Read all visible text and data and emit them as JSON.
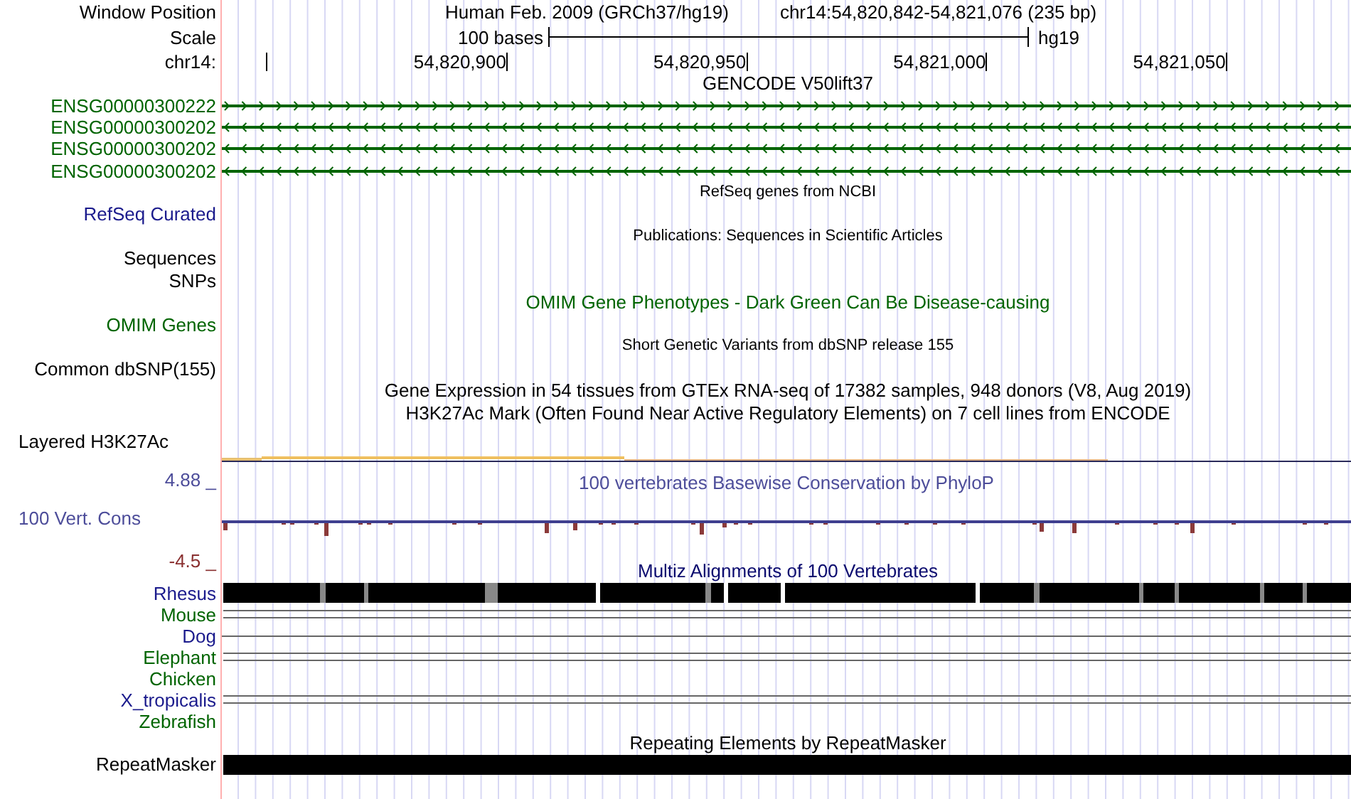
{
  "tracks": [
    {
      "kind": "header",
      "label": "Window Position",
      "assembly": "Human Feb. 2009 (GRCh37/hg19)",
      "position": "chr14:54,820,842-54,821,076 (235 bp)"
    },
    {
      "kind": "scale",
      "label": "Scale",
      "length": "100 bases",
      "db": "hg19"
    },
    {
      "kind": "ruler",
      "label": "chr14:",
      "ticks": [
        "54,820,900",
        "54,820,950",
        "54,821,000",
        "54,821,050"
      ]
    },
    {
      "kind": "title",
      "text": "GENCODE V50lift37",
      "color": "#000000"
    },
    {
      "kind": "gene_forward",
      "label": "ENSG00000300222",
      "color": "#006400"
    },
    {
      "kind": "gene_reverse",
      "label": "ENSG00000300202",
      "color": "#006400"
    },
    {
      "kind": "gene_reverse",
      "label": "ENSG00000300202",
      "color": "#006400"
    },
    {
      "kind": "gene_reverse",
      "label": "ENSG00000300202",
      "color": "#006400"
    },
    {
      "kind": "subtitle",
      "text": "RefSeq genes from NCBI",
      "color": "#000000"
    },
    {
      "kind": "label",
      "label": "RefSeq Curated",
      "color": "#1a1a8c"
    },
    {
      "kind": "subtitle",
      "text": "Publications: Sequences in Scientific Articles",
      "color": "#000000"
    },
    {
      "kind": "label",
      "label": "Sequences",
      "color": "#000000"
    },
    {
      "kind": "label",
      "label": "SNPs",
      "color": "#000000"
    },
    {
      "kind": "title",
      "text": "OMIM Gene Phenotypes - Dark Green Can Be Disease-causing",
      "color": "#006400"
    },
    {
      "kind": "label",
      "label": "OMIM Genes",
      "color": "#006400"
    },
    {
      "kind": "subtitle",
      "text": "Short Genetic Variants from dbSNP release 155",
      "color": "#000000"
    },
    {
      "kind": "label",
      "label": "Common dbSNP(155)",
      "color": "#000000"
    },
    {
      "kind": "title",
      "text": "Gene Expression in 54 tissues from GTEx RNA-seq of 17382 samples, 948 donors (V8, Aug 2019)",
      "color": "#000000"
    },
    {
      "kind": "title",
      "text": "H3K27Ac Mark (Often Found Near Active Regulatory Elements) on 7 cell lines from ENCODE",
      "color": "#000000"
    },
    {
      "kind": "signal",
      "label": "Layered H3K27Ac"
    },
    {
      "kind": "conservation",
      "label": "100 Vert. Cons",
      "title": "100 vertebrates Basewise Conservation by PhyloP",
      "max": "4.88 _",
      "min": "-4.5 _"
    },
    {
      "kind": "title",
      "text": "Multiz Alignments of 100 Vertebrates",
      "color": "#0a0a6e"
    },
    {
      "kind": "species_blocks",
      "label": "Rhesus",
      "color": "#1a1a8c"
    },
    {
      "kind": "species_double",
      "label": "Mouse",
      "color": "#006400"
    },
    {
      "kind": "species_single",
      "label": "Dog",
      "color": "#1a1a8c"
    },
    {
      "kind": "species_double",
      "label": "Elephant",
      "color": "#006400"
    },
    {
      "kind": "species_none",
      "label": "Chicken",
      "color": "#006400"
    },
    {
      "kind": "species_double",
      "label": "X_tropicalis",
      "color": "#1a1a8c"
    },
    {
      "kind": "species_none",
      "label": "Zebrafish",
      "color": "#006400"
    },
    {
      "kind": "title",
      "text": "Repeating Elements by RepeatMasker",
      "color": "#000000"
    },
    {
      "kind": "repeat",
      "label": "RepeatMasker"
    }
  ]
}
